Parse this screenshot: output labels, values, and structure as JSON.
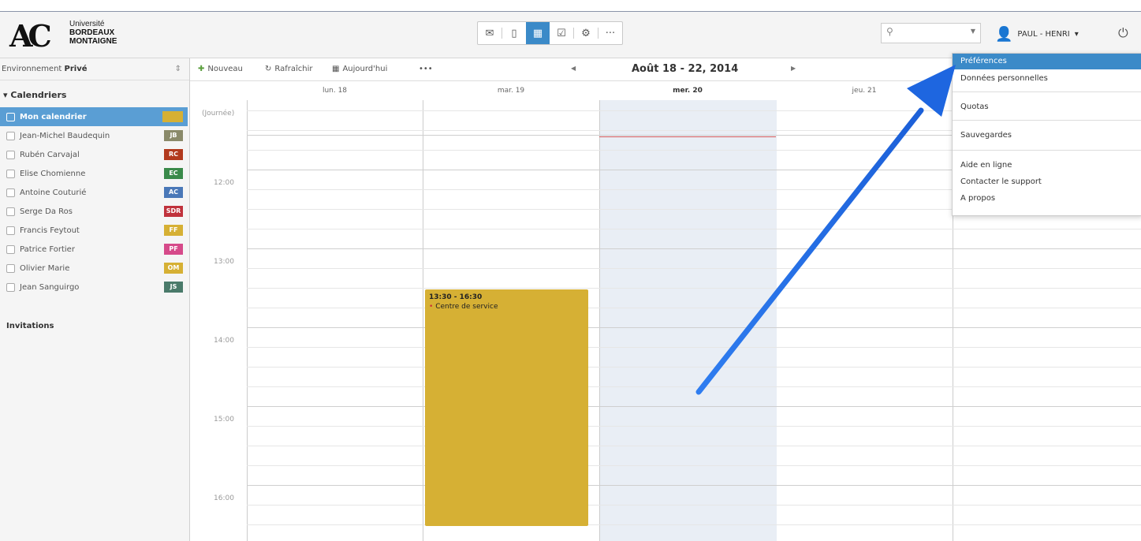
{
  "logo": {
    "line1": "Université",
    "line2": "BORDEAUX",
    "line3": "MONTAIGNE",
    "mark": "AC"
  },
  "toolbar_icons": [
    "mail-icon",
    "contacts-icon",
    "calendar-icon",
    "tasks-icon",
    "settings-icon",
    "more-icon"
  ],
  "search": {
    "placeholder": ""
  },
  "user": {
    "name": "PAUL - HENRI"
  },
  "sidebar": {
    "env_label": "Environnement",
    "env_value": "Privé",
    "calendars_heading": "Calendriers",
    "calendars": [
      {
        "name": "Mon calendrier",
        "badge": "",
        "color": "#d6b034",
        "selected": true
      },
      {
        "name": "Jean-Michel Baudequin",
        "badge": "JB",
        "color": "#8a8a6a"
      },
      {
        "name": "Rubén Carvajal",
        "badge": "RC",
        "color": "#b23a1e"
      },
      {
        "name": "Elise Chomienne",
        "badge": "EC",
        "color": "#3a8a4a"
      },
      {
        "name": "Antoine Couturié",
        "badge": "AC",
        "color": "#4a78b8"
      },
      {
        "name": "Serge Da Ros",
        "badge": "SDR",
        "color": "#c0323c"
      },
      {
        "name": "Francis Feytout",
        "badge": "FF",
        "color": "#d6b034"
      },
      {
        "name": "Patrice Fortier",
        "badge": "PF",
        "color": "#d64a8a"
      },
      {
        "name": "Olivier Marie",
        "badge": "OM",
        "color": "#d6b034"
      },
      {
        "name": "Jean Sanguirgo",
        "badge": "JS",
        "color": "#4a7a6a"
      }
    ],
    "invitations": "Invitations"
  },
  "actions": {
    "new": "Nouveau",
    "refresh": "Rafraîchir",
    "today": "Aujourd'hui",
    "more": "•••"
  },
  "date_range": "Août 18 - 22, 2014",
  "days": [
    {
      "label": "lun. 18"
    },
    {
      "label": "mar. 19"
    },
    {
      "label": "mer. 20",
      "today": true
    },
    {
      "label": "jeu. 21"
    },
    {
      "label": ""
    }
  ],
  "allday_label": "Journée",
  "hours": [
    "12:00",
    "13:00",
    "14:00",
    "15:00",
    "16:00"
  ],
  "event": {
    "time": "13:30 - 16:30",
    "title": "Centre de service",
    "color": "#d6b034"
  },
  "menu": {
    "items": [
      {
        "label": "Préférences",
        "active": true
      },
      {
        "label": "Données personnelles"
      },
      {
        "label": "Quotas"
      },
      {
        "label": "Sauvegardes"
      },
      {
        "label": "Aide en ligne"
      },
      {
        "label": "Contacter le support"
      },
      {
        "label": "A propos"
      }
    ]
  }
}
